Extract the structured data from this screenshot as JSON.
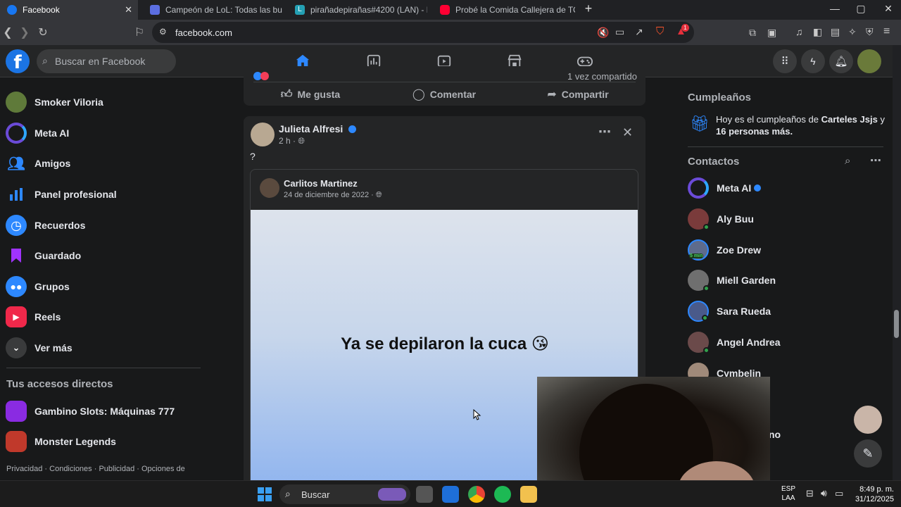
{
  "browser": {
    "tabs": [
      {
        "title": "Facebook",
        "active": true,
        "color": "#1877f2"
      },
      {
        "title": "Campeón de LoL: Todas las builds, tie",
        "active": false,
        "color": "#5b6ee1"
      },
      {
        "title": "pirañadepirañas#4200 (LAN) - Leagu",
        "active": false,
        "color": "#24a0b4"
      },
      {
        "title": "Probé la Comida Callejera de TODO e",
        "active": false,
        "color": "#ff0033"
      }
    ],
    "url": "facebook.com",
    "shield_badge": "1"
  },
  "header": {
    "logo": "f",
    "search_placeholder": "Buscar en Facebook",
    "nav_icons": [
      "home-icon",
      "dashboard-icon",
      "video-icon",
      "marketplace-icon",
      "gaming-icon"
    ]
  },
  "sidebar": {
    "items": [
      {
        "label": "Smoker Viloria",
        "icon": "avatar",
        "color": "#5f7a3a"
      },
      {
        "label": "Meta AI",
        "icon": "meta-ai-icon",
        "color": "#6b4bd8"
      },
      {
        "label": "Amigos",
        "icon": "friends-icon",
        "color": "#2d88ff"
      },
      {
        "label": "Panel profesional",
        "icon": "dashboard-icon",
        "color": "#2d88ff"
      },
      {
        "label": "Recuerdos",
        "icon": "clock-icon",
        "color": "#2d88ff"
      },
      {
        "label": "Guardado",
        "icon": "bookmark-icon",
        "color": "#a033ff"
      },
      {
        "label": "Grupos",
        "icon": "groups-icon",
        "color": "#2d88ff"
      },
      {
        "label": "Reels",
        "icon": "reels-icon",
        "color": "#f0284a"
      },
      {
        "label": "Ver más",
        "icon": "chevron-down-icon",
        "color": "#3a3b3c"
      }
    ],
    "shortcuts_title": "Tus accesos directos",
    "shortcuts": [
      {
        "label": "Gambino Slots: Máquinas 777",
        "color": "#8a2be2"
      },
      {
        "label": "Monster Legends",
        "color": "#c0392b"
      }
    ],
    "footer": "Privacidad · Condiciones · Publicidad · Opciones de"
  },
  "feed": {
    "prev_post": {
      "shares": "1 vez compartido",
      "like_label": "Me gusta",
      "comment_label": "Comentar",
      "share_label": "Compartir"
    },
    "post": {
      "author": "Julieta Alfresi",
      "time": "2 h ·",
      "text": "?",
      "shared": {
        "author": "Carlitos Martinez",
        "date": "24 de diciembre de 2022 ·",
        "image_text": "Ya se depilaron la cuca",
        "emoji": "😘"
      }
    }
  },
  "right": {
    "birthdays_title": "Cumpleaños",
    "birthday_prefix": "Hoy es el cumpleaños de ",
    "birthday_name": "Carteles Jsjs",
    "birthday_suffix": " y",
    "birthday_others": "16 personas más.",
    "contacts_title": "Contactos",
    "contacts": [
      {
        "name": "Meta AI",
        "color": "#6b4bd8",
        "online": false,
        "verified": true
      },
      {
        "name": "Aly Buu",
        "color": "#7a3b3b",
        "online": true
      },
      {
        "name": "Zoe Drew",
        "color": "#5e6b8c",
        "online": false,
        "badge": "5 min"
      },
      {
        "name": "Miell Garden",
        "color": "#6f6f6f",
        "online": true
      },
      {
        "name": "Sara Rueda",
        "color": "#4a5a8a",
        "online": true
      },
      {
        "name": "Angel Andrea",
        "color": "#6b4a4a",
        "online": true
      },
      {
        "name": "Cymbelin",
        "color": "#a08a7a",
        "online": false
      }
    ],
    "partial_contact": "no"
  },
  "taskbar": {
    "search_label": "Buscar",
    "lang": "ESP",
    "lang_sub": "LAA",
    "time": "8:49 p. m.",
    "date": "31/12/2025"
  }
}
